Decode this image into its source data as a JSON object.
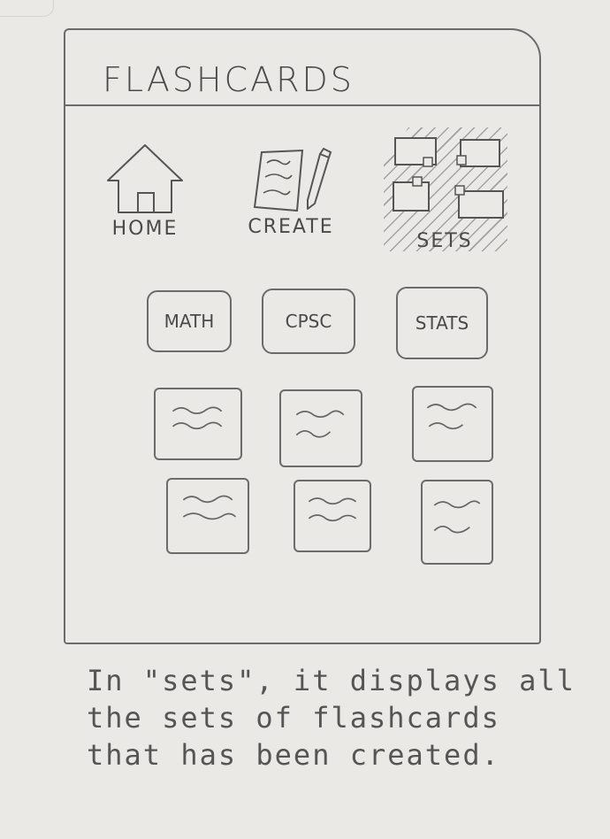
{
  "header": {
    "title": "FLASHCARDS"
  },
  "nav": {
    "home_label": "HOME",
    "create_label": "CREATE",
    "sets_label": "SETS",
    "home_icon": "house-icon",
    "create_icon": "note-pencil-icon",
    "sets_icon": "sets-grid-icon"
  },
  "sets": [
    {
      "label": "MATH"
    },
    {
      "label": "CPSC"
    },
    {
      "label": "STATS"
    }
  ],
  "caption": {
    "line1": "In \"sets\", it displays all",
    "line2": "the sets of flashcards",
    "line3": "that has been created."
  }
}
